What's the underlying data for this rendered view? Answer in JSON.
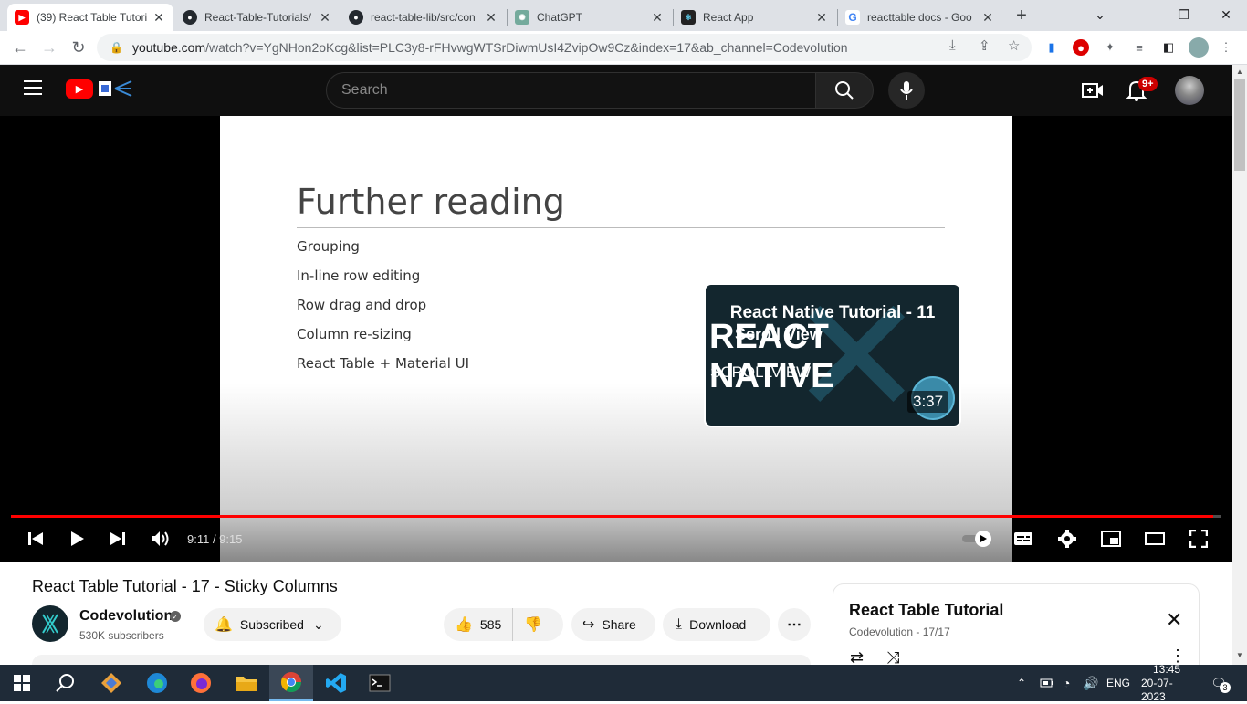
{
  "browser": {
    "tabs": [
      {
        "title": "(39) React Table Tutori",
        "favicon": "youtube-icon",
        "active": true
      },
      {
        "title": "React-Table-Tutorials/",
        "favicon": "github-icon",
        "active": false
      },
      {
        "title": "react-table-lib/src/con",
        "favicon": "github-icon",
        "active": false
      },
      {
        "title": "ChatGPT",
        "favicon": "chatgpt-icon",
        "active": false
      },
      {
        "title": "React App",
        "favicon": "react-icon",
        "active": false
      },
      {
        "title": "reacttable docs - Goo",
        "favicon": "google-icon",
        "active": false
      }
    ],
    "url_domain": "youtube.com",
    "url_rest": "/watch?v=YgNHon2oKcg&list=PLC3y8-rFHvwgWTSrDiwmUsI4ZvipOw9Cz&index=17&ab_channel=Codevolution"
  },
  "youtube": {
    "search_placeholder": "Search",
    "notification_badge": "9+",
    "player": {
      "slide_title": "Further reading",
      "slide_bullets": [
        "Grouping",
        "In-line row editing",
        "Row drag and drop",
        "Column re-sizing",
        "React Table + Material UI"
      ],
      "endcard": {
        "title": "React Native Tutorial - 11",
        "overlay_title": "Scroll View",
        "big_text": "REACT NATIVE",
        "sub_text": "SCROLLVIEW",
        "duration": "3:37"
      },
      "time": "9:11 / 9:15",
      "progress_fraction": 0.993
    },
    "video": {
      "title": "React Table Tutorial - 17 - Sticky Columns",
      "channel_name": "Codevolution",
      "subscribers": "530K subscribers",
      "subscribed_label": "Subscribed",
      "likes": "585",
      "share_label": "Share",
      "download_label": "Download"
    },
    "playlist": {
      "title": "React Table Tutorial",
      "subtitle": "Codevolution - 17/17"
    }
  },
  "taskbar": {
    "language": "ENG",
    "time": "13:45",
    "date": "20-07-2023",
    "notification_count": "3"
  },
  "colors": {
    "youtube_red": "#ff0000",
    "chrome_tabstrip": "#dee1e6",
    "youtube_dark": "#0f0f0f",
    "taskbar": "#1f2b38"
  }
}
